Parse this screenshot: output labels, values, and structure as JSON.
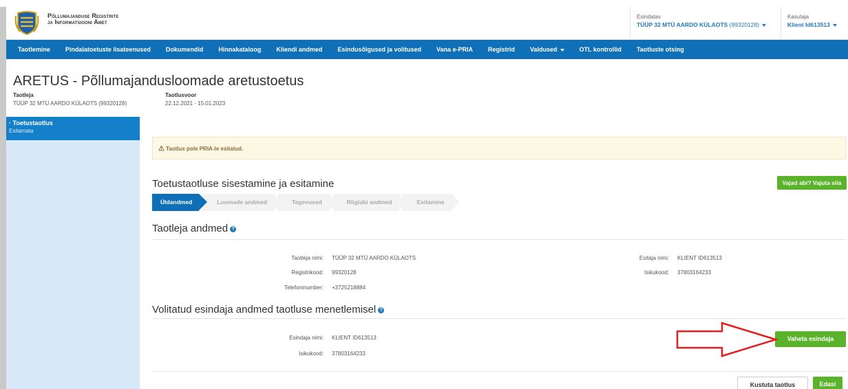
{
  "header": {
    "org_line1": "Põllumajanduse Registrite",
    "org_line2": "ja Informatsiooni Amet",
    "represented_label": "Esindatav",
    "represented_name": "TÜÜP 32 MTÜ AARDO KÜLAOTS",
    "represented_code": "(99320128)",
    "user_label": "Kasutaja",
    "user_name": "Klient Id613513"
  },
  "nav": [
    {
      "label": "Taotlemine"
    },
    {
      "label": "Pindalatoetuste lisateenused"
    },
    {
      "label": "Dokumendid"
    },
    {
      "label": "Hinnakataloog"
    },
    {
      "label": "Kliendi andmed"
    },
    {
      "label": "Esindusõigused ja volitused"
    },
    {
      "label": "Vana e-PRIA"
    },
    {
      "label": "Registrid"
    },
    {
      "label": "Valdused"
    },
    {
      "label": "OTL kontrollid"
    },
    {
      "label": "Taotluste otsing"
    }
  ],
  "page": {
    "title": "ARETUS - Põllumajandusloomade aretustoetus",
    "applicant_label": "Taotleja",
    "applicant_value": "TÜÜP 32 MTÜ AARDO KÜLAOTS (99320128)",
    "round_label": "Taotlusvoor",
    "round_value": "22.12.2021 - 15.01.2023"
  },
  "sidebar": {
    "items": [
      {
        "title": "Toetustaotlus",
        "status": "Esitamata"
      }
    ]
  },
  "alert": {
    "text": "Taotlus pole PRIA-le esitatud."
  },
  "wizard": {
    "title": "Toetustaotluse sisestamine ja esitamine",
    "help_button": "Vajad abi? Vajuta siia",
    "steps": [
      {
        "label": "Üldandmed"
      },
      {
        "label": "Loomade andmed"
      },
      {
        "label": "Tegevused"
      },
      {
        "label": "Riigiabi andmed"
      },
      {
        "label": "Esitamine"
      }
    ]
  },
  "applicant_section": {
    "title": "Taotleja andmed",
    "name_label": "Taotleja nimi:",
    "name_value": "TÜÜP 32 MTÜ AARDO KÜLAOTS",
    "reg_label": "Registrikood:",
    "reg_value": "99320128",
    "phone_label": "Telefoninumber:",
    "phone_value": "+3725218884",
    "submitter_label": "Esitaja nimi:",
    "submitter_value": "KLIENT ID613513",
    "idcode_label": "Isikukood:",
    "idcode_value": "37803164233"
  },
  "representative_section": {
    "title": "Volitatud esindaja andmed taotluse menetlemisel",
    "name_label": "Esindaja nimi:",
    "name_value": "KLIENT ID613513",
    "idcode_label": "Isikukood:",
    "idcode_value": "37803164233",
    "change_button": "Vaheta esindaja"
  },
  "footer_actions": {
    "delete_button": "Kustuta taotlus",
    "next_button": "Edasi"
  },
  "colors": {
    "nav_bg": "#0f70b7",
    "accent_green": "#5ab32a",
    "arrow_red": "#e41e1e"
  }
}
